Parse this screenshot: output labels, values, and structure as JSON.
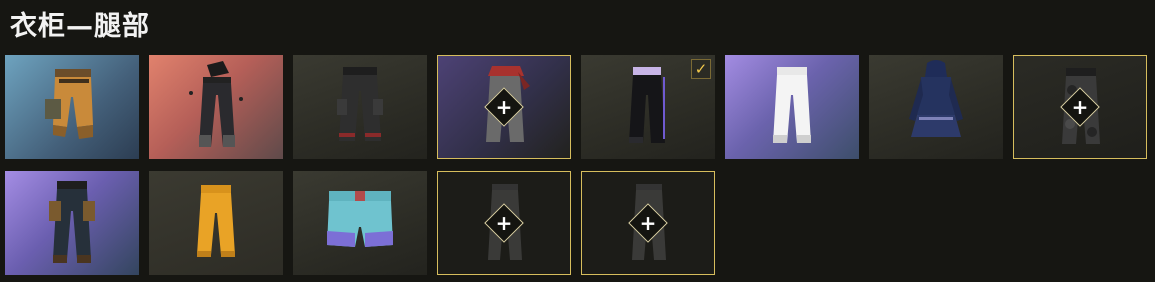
{
  "header": {
    "title": "衣柜—腿部"
  },
  "wardrobe": {
    "equipped_mark": "✓",
    "add_glyph": "+",
    "colors": {
      "accent_border": "#d6bd5d",
      "checkmark": "#f3c94b",
      "background": "#161612"
    },
    "items": [
      {
        "kind": "cargo-shorts-orange",
        "rarity_bg": "blue",
        "equipped": false,
        "empty": false
      },
      {
        "kind": "black-pants-with-belt",
        "rarity_bg": "coral",
        "equipped": false,
        "empty": false
      },
      {
        "kind": "black-cargo-pants",
        "rarity_bg": "olive",
        "equipped": false,
        "empty": false
      },
      {
        "kind": "grey-pants-red-sash",
        "rarity_bg": "purple",
        "equipped": false,
        "empty": false,
        "selected": true,
        "add_overlay": true
      },
      {
        "kind": "black-track-pants",
        "rarity_bg": "olive",
        "equipped": true,
        "empty": false
      },
      {
        "kind": "white-track-pants",
        "rarity_bg": "purple",
        "equipped": false,
        "empty": false
      },
      {
        "kind": "navy-hooded-outfit",
        "rarity_bg": "olive",
        "equipped": false,
        "empty": false
      },
      {
        "kind": "camo-pants",
        "rarity_bg": "dark",
        "equipped": false,
        "empty": false,
        "selected": true,
        "add_overlay": true
      },
      {
        "kind": "armored-tactical-pants",
        "rarity_bg": "purple",
        "equipped": false,
        "empty": false
      },
      {
        "kind": "orange-joggers",
        "rarity_bg": "olive",
        "equipped": false,
        "empty": false
      },
      {
        "kind": "teal-shorts",
        "rarity_bg": "olive",
        "equipped": false,
        "empty": false
      },
      {
        "kind": "empty-slot",
        "empty": true,
        "add_overlay": true
      },
      {
        "kind": "empty-slot",
        "empty": true,
        "add_overlay": true
      }
    ]
  }
}
